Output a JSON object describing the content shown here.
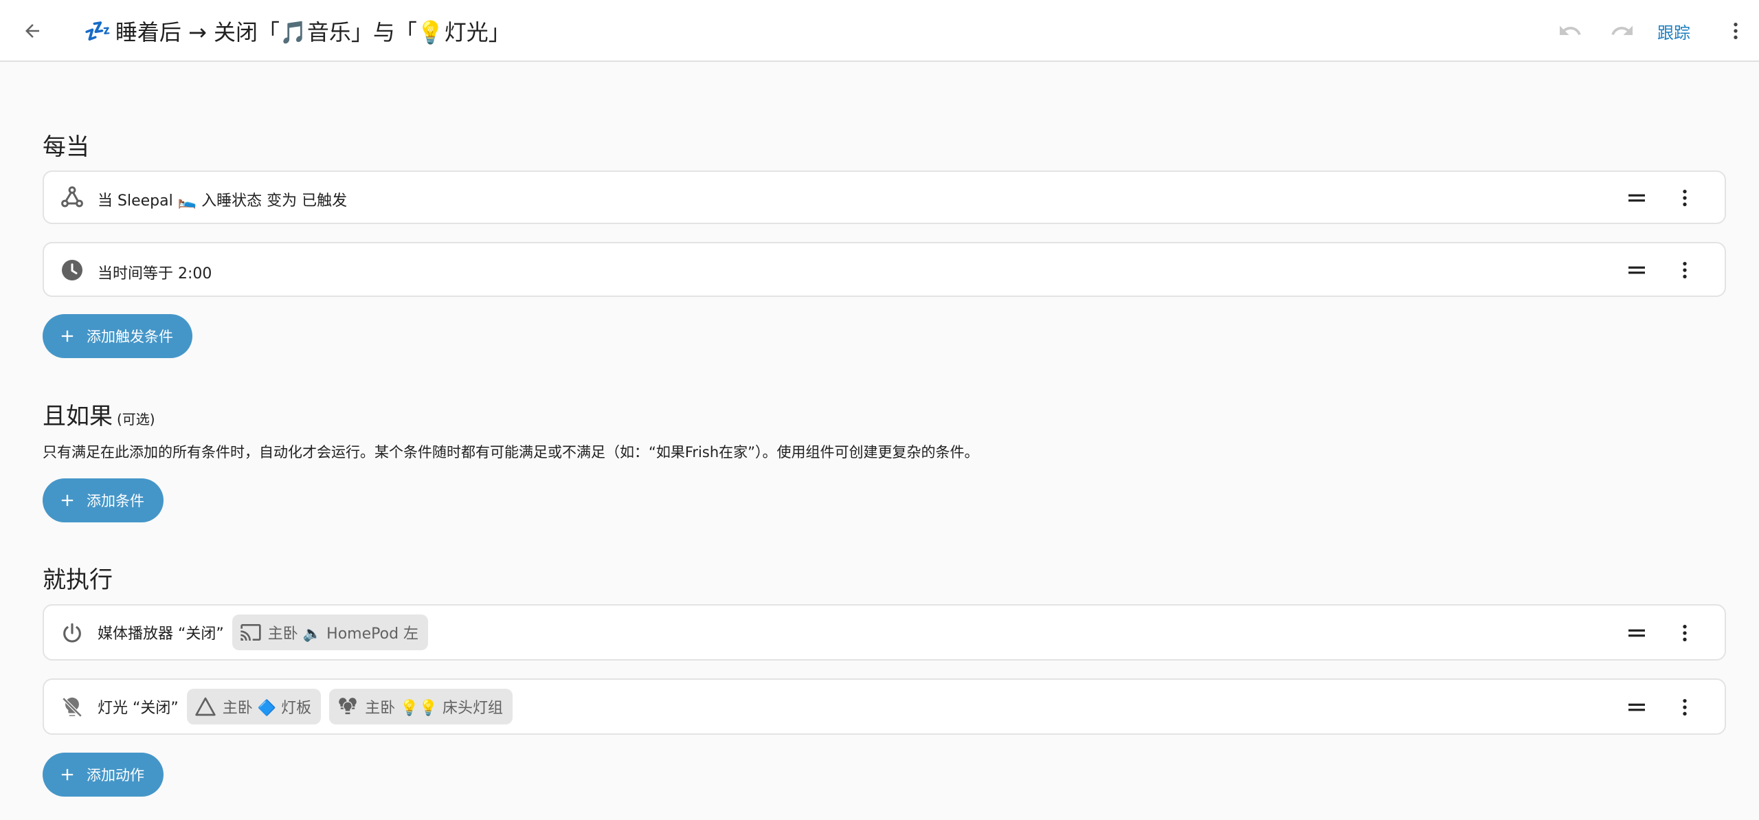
{
  "header": {
    "title": "睡着后 → 关闭「🎵音乐」与「💡灯光」",
    "title_emoji": "💤",
    "trace_label": "跟踪",
    "icons": {
      "back": "arrow-left-icon",
      "undo": "undo-icon",
      "redo": "redo-icon",
      "more": "more-vertical-icon"
    }
  },
  "triggers": {
    "heading": "每当",
    "items": [
      {
        "icon": "webhook-icon",
        "text": "当 Sleepal 🛌 入睡状态 变为 已触发"
      },
      {
        "icon": "clock-icon",
        "text": "当时间等于 2:00"
      }
    ],
    "add_label": "添加触发条件"
  },
  "conditions": {
    "heading": "且如果",
    "optional_label": "(可选)",
    "description": "只有满足在此添加的所有条件时，自动化才会运行。某个条件随时都有可能满足或不满足（如：“如果Frish在家”）。使用组件可创建更复杂的条件。",
    "add_label": "添加条件"
  },
  "actions": {
    "heading": "就执行",
    "items": [
      {
        "icon": "power-icon",
        "text": "媒体播放器 “关闭”",
        "chips": [
          {
            "icon": "cast-icon",
            "label": "主卧 🔈 HomePod 左"
          }
        ]
      },
      {
        "icon": "lightbulb-off-icon",
        "text": "灯光 “关闭”",
        "chips": [
          {
            "icon": "triangle-outline-icon",
            "label": "主卧 🔷 灯板"
          },
          {
            "icon": "lightbulb-group-icon",
            "label": "主卧 💡💡 床头灯组"
          }
        ]
      }
    ],
    "add_label": "添加动作"
  },
  "colors": {
    "accent": "#4596c8",
    "link": "#1f7fbf",
    "background": "#fafafa",
    "card": "#ffffff",
    "chip": "#e6e6e6",
    "icon": "#616161"
  }
}
